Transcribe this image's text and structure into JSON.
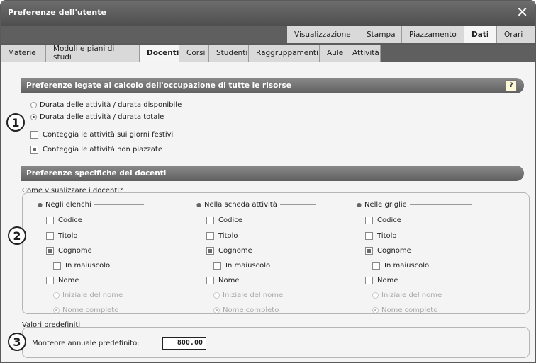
{
  "window": {
    "title": "Preferenze dell'utente"
  },
  "tabs_top": [
    {
      "label": "Visualizzazione",
      "active": false
    },
    {
      "label": "Stampa",
      "active": false
    },
    {
      "label": "Piazzamento",
      "active": false
    },
    {
      "label": "Dati",
      "active": true
    },
    {
      "label": "Orari",
      "active": false
    }
  ],
  "tabs_sub": [
    {
      "label": "Materie",
      "active": false
    },
    {
      "label": "Moduli e piani di studi",
      "active": false
    },
    {
      "label": "Docenti",
      "active": true
    },
    {
      "label": "Corsi",
      "active": false
    },
    {
      "label": "Studenti",
      "active": false
    },
    {
      "label": "Raggruppamenti",
      "active": false
    },
    {
      "label": "Aule",
      "active": false
    },
    {
      "label": "Attività",
      "active": false
    }
  ],
  "section1": {
    "title": "Preferenze legate al calcolo dell'occupazione di tutte le risorse",
    "radio1": "Durata delle attività / durata disponibile",
    "radio2": "Durata delle attività / durata totale",
    "check1": "Conteggia le attività sui giorni festivi",
    "check2": "Conteggia le attività non piazzate"
  },
  "section2": {
    "title": "Preferenze specifiche dei docenti",
    "question": "Come visualizzare i docenti?",
    "columns": [
      {
        "title": "Negli elenchi"
      },
      {
        "title": "Nella scheda attività"
      },
      {
        "title": "Nelle griglie"
      }
    ],
    "options": {
      "codice": "Codice",
      "titolo": "Titolo",
      "cognome": "Cognome",
      "maiuscolo": "In maiuscolo",
      "nome": "Nome",
      "iniziale": "Iniziale del nome",
      "completo": "Nome completo"
    }
  },
  "defaults": {
    "title": "Valori predefiniti",
    "label": "Monteore annuale predefinito:",
    "value": "800.00"
  },
  "markers": {
    "m1": "1",
    "m2": "2",
    "m3": "3"
  }
}
